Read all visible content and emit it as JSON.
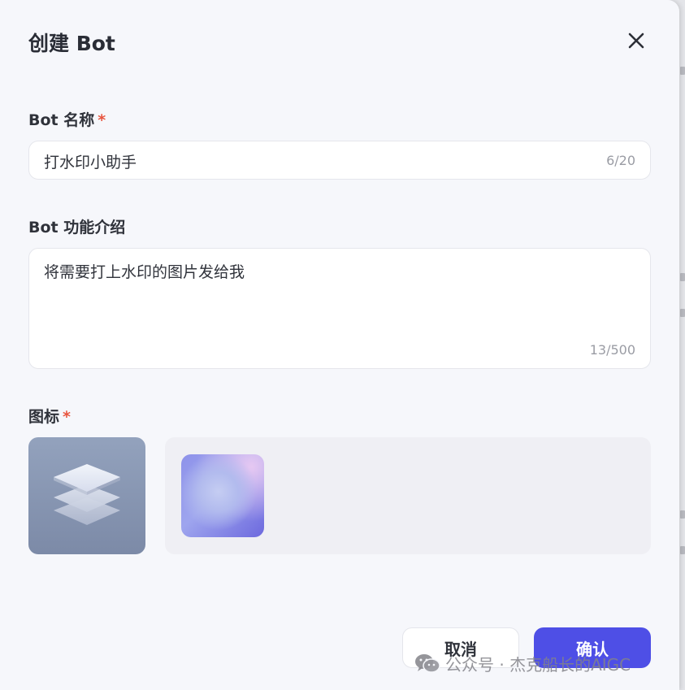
{
  "dialog": {
    "title": "创建 Bot",
    "close_icon": "close-icon"
  },
  "bot_name": {
    "label": "Bot 名称",
    "required_mark": "*",
    "value": "打水印小助手",
    "counter": "6/20"
  },
  "bot_desc": {
    "label": "Bot 功能介绍",
    "value": "将需要打上水印的图片发给我",
    "counter": "13/500"
  },
  "icon_section": {
    "label": "图标",
    "required_mark": "*",
    "preview_icon": "layers-icon"
  },
  "actions": {
    "cancel_label": "取消",
    "confirm_label": "确认"
  },
  "watermark": {
    "text": "公众号 · 杰克船长的AIGC",
    "icon": "wechat-icon"
  },
  "colors": {
    "accent": "#4e4fe6",
    "required": "#e8553f",
    "background": "#f6f7fb"
  }
}
